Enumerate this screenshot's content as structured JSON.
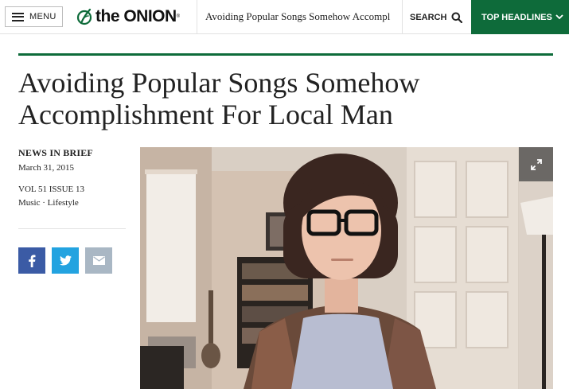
{
  "header": {
    "menu_label": "MENU",
    "logo_text": "the ONION",
    "logo_tm": "®",
    "article_title": "Avoiding Popular Songs Somehow Accompl",
    "search_label": "SEARCH",
    "top_headlines_label": "TOP HEADLINES"
  },
  "article": {
    "headline": "Avoiding Popular Songs Somehow Accomplishment For Local Man",
    "category": "NEWS IN BRIEF",
    "date": "March 31, 2015",
    "volume": "VOL 51 ISSUE 13",
    "tags": [
      "Music",
      "Lifestyle"
    ],
    "tag_separator": " · "
  },
  "share": {
    "facebook_icon": "f",
    "icons": [
      "facebook-icon",
      "twitter-icon",
      "email-icon"
    ]
  },
  "colors": {
    "brand_green": "#0e6b3a",
    "facebook": "#3b5ba5",
    "twitter": "#23a3e0",
    "email": "#a9b7c4"
  }
}
